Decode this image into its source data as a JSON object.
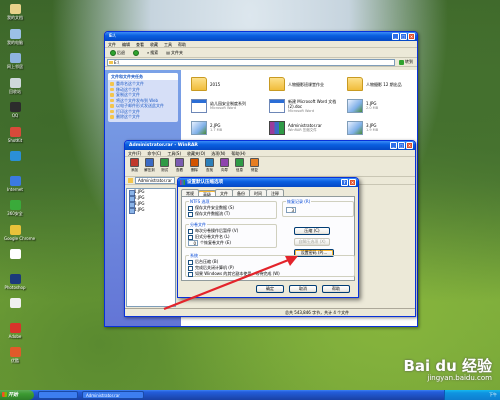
{
  "desktop": {
    "icons": [
      {
        "label": "我的文档",
        "color": "#e8d28a"
      },
      {
        "label": "我的电脑",
        "color": "#9cc0e6"
      },
      {
        "label": "网上邻居",
        "color": "#8fb4e0"
      },
      {
        "label": "回收站",
        "color": "#cfd8dc"
      },
      {
        "label": "QQ",
        "color": "#2c2c2c"
      },
      {
        "label": "ShotKit",
        "color": "#d84a3a"
      },
      {
        "label": "",
        "color": "#2b8fd6"
      },
      {
        "label": "Internet",
        "color": "#3b7ae0"
      },
      {
        "label": "360安全",
        "color": "#3aaa3a"
      },
      {
        "label": "Google Chrome",
        "color": "#e8c23a"
      },
      {
        "label": "",
        "color": "#ffffff"
      },
      {
        "label": "Photoshop",
        "color": "#1c3a7a"
      },
      {
        "label": "",
        "color": "#f0f0f0"
      },
      {
        "label": "Adobe",
        "color": "#d8342a"
      },
      {
        "label": "优酷",
        "color": "#e05a2a"
      }
    ]
  },
  "explorer": {
    "title": "E:\\",
    "menu": [
      "文件",
      "编辑",
      "查看",
      "收藏",
      "工具",
      "帮助"
    ],
    "toolbar": {
      "back": "后退",
      "search": "搜索",
      "folders": "文件夹"
    },
    "address": "E:\\",
    "go": "转到",
    "task_pane": {
      "title": "文件和文件夹任务",
      "items": [
        "重命名这个文件",
        "移动这个文件",
        "复制这个文件",
        "将这个文件发布到 Web",
        "以电子邮件形式发送此文件",
        "打印这个文件",
        "删除这个文件"
      ]
    },
    "files": [
      {
        "name": "2015",
        "sub": "",
        "type": "folder"
      },
      {
        "name": "人物摄影班课堂作业",
        "sub": "",
        "type": "folder"
      },
      {
        "name": "人物摄影 12 期出品",
        "sub": "",
        "type": "folder"
      },
      {
        "name": "幼儿园安全制度系列",
        "sub": "Microsoft Word",
        "type": "doc"
      },
      {
        "name": "新建 Microsoft Word 文档 (2).doc",
        "sub": "Microsoft Word",
        "type": "doc"
      },
      {
        "name": "1.JPG",
        "sub": "2.0 MB",
        "type": "img"
      },
      {
        "name": "2.JPG",
        "sub": "1.7 MB",
        "type": "img"
      },
      {
        "name": "Administrator.rar",
        "sub": "WinRAR 压缩文件",
        "type": "rar"
      },
      {
        "name": "3.JPG",
        "sub": "1.9 MB",
        "type": "img"
      }
    ]
  },
  "winrar": {
    "title": "Administrator.rar - WinRAR",
    "menu": [
      "文件(F)",
      "命令(C)",
      "工具(S)",
      "收藏夹(O)",
      "选项(N)",
      "帮助(H)"
    ],
    "tools": [
      "添加",
      "解压到",
      "测试",
      "查看",
      "删除",
      "查找",
      "向导",
      "信息",
      "修复"
    ],
    "path": "Administrator.rar",
    "list": [
      "1.JPG",
      "2.JPG",
      "3.JPG",
      "4.JPG"
    ],
    "status": "总共 543,846 字节，共计 4 个文件"
  },
  "dialog": {
    "title": "设置默认压缩选项",
    "tabs": [
      "常规",
      "高级",
      "文件",
      "备份",
      "时间",
      "注释"
    ],
    "active_tab": 1,
    "ntfs": {
      "title": "NTFS 选项",
      "items": [
        "保存文件安全数据 (S)",
        "保存文件数据流 (T)"
      ]
    },
    "recovery": {
      "title": "恢复记录 (R)",
      "value": "3"
    },
    "volumes": {
      "title": "分卷文件",
      "items": [
        "每次分卷操作后暂停 (V)",
        "旧式分卷文件名 (L)"
      ],
      "spin_value": "0",
      "spin_label": "个恢复卷文件 (E)"
    },
    "system": {
      "title": "系统",
      "items": [
        "后台压缩 (B)",
        "完成后关闭计算机 (P)",
        "如果 Windows 的其它副本使用，等待完成 (W)"
      ]
    },
    "buttons": {
      "compress": "压缩 (C)",
      "sfx": "自解压选项 (X)",
      "password": "设置密码 (P)...",
      "ok": "确定",
      "cancel": "取消",
      "help": "帮助"
    }
  },
  "taskbar": {
    "start": "开始",
    "buttons": [
      "",
      "Administrator.rar"
    ],
    "tray": "下午"
  },
  "watermark": {
    "brand": "Bai du 经验",
    "url": "jingyan.baidu.com"
  },
  "annotation": {
    "color": "#e3242b"
  }
}
